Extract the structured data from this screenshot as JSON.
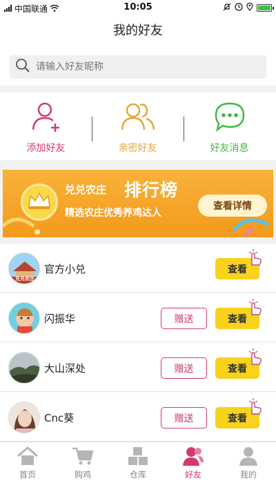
{
  "status_bar": {
    "carrier": "中国联通",
    "time": "10:05"
  },
  "header": {
    "title": "我的好友"
  },
  "search": {
    "placeholder": "请输入好友昵称"
  },
  "actions": [
    {
      "label": "添加好友",
      "color": "#d33a6c",
      "icon": "add-user-icon"
    },
    {
      "label": "亲密好友",
      "color": "#e4a63a",
      "icon": "group-icon"
    },
    {
      "label": "好友消息",
      "color": "#3dbb3d",
      "icon": "chat-bubble-icon"
    }
  ],
  "banner": {
    "brand": "兑兑农庄",
    "title": "排行榜",
    "subtitle": "精选农庄优秀养鸡达人",
    "button": "查看详情"
  },
  "friends": [
    {
      "name": "官方小兑",
      "avatar_text": "兑兑农庄",
      "view": "查看",
      "gift": ""
    },
    {
      "name": "闪振华",
      "view": "查看",
      "gift": "赠送"
    },
    {
      "name": "大山深处",
      "view": "查看",
      "gift": "赠送"
    },
    {
      "name": "Cnc葵",
      "view": "查看",
      "gift": "赠送"
    }
  ],
  "tabs": [
    {
      "label": "首页",
      "icon": "home-icon"
    },
    {
      "label": "购鸡",
      "icon": "cart-icon"
    },
    {
      "label": "仓库",
      "icon": "boxes-icon"
    },
    {
      "label": "好友",
      "icon": "friends-icon",
      "active": true
    },
    {
      "label": "我的",
      "icon": "profile-icon"
    }
  ],
  "colors": {
    "accent": "#d33a6c",
    "yellow": "#f8d21c",
    "banner": "#f39a1c"
  }
}
